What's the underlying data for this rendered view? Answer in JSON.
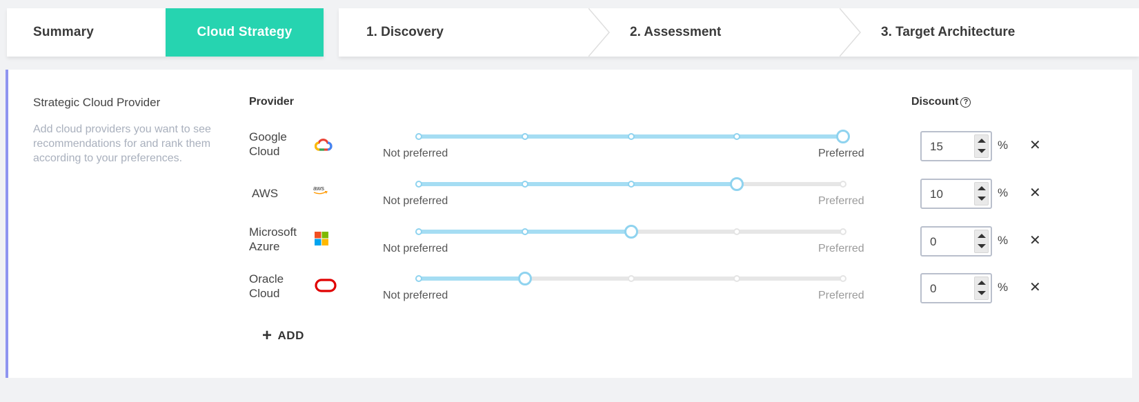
{
  "tabs": {
    "summary": "Summary",
    "active": "Cloud Strategy",
    "steps": [
      "1. Discovery",
      "2. Assessment",
      "3. Target Architecture"
    ]
  },
  "colors": {
    "active_tab": "#26d4b0",
    "accent_border": "#8f95f0",
    "slider_fill": "#a5ddf3",
    "oracle_red": "#e00000"
  },
  "section": {
    "title": "Strategic Cloud Provider",
    "description": "Add cloud providers you want to see recommendations for and rank them according to your preferences."
  },
  "columns": {
    "provider": "Provider",
    "discount": "Discount",
    "help_icon": "?"
  },
  "scale": {
    "min_label": "Not preferred",
    "max_label": "Preferred",
    "steps": 5
  },
  "providers": [
    {
      "name_line1": "Google",
      "name_line2": "Cloud",
      "logo": "google-cloud-logo",
      "preference": 5,
      "discount": "15",
      "unit": "%"
    },
    {
      "name_line1": "AWS",
      "name_line2": "",
      "logo": "aws-logo",
      "preference": 4,
      "discount": "10",
      "unit": "%"
    },
    {
      "name_line1": "Microsoft",
      "name_line2": "Azure",
      "logo": "microsoft-logo",
      "preference": 3,
      "discount": "0",
      "unit": "%"
    },
    {
      "name_line1": "Oracle",
      "name_line2": "Cloud",
      "logo": "oracle-logo",
      "preference": 2,
      "discount": "0",
      "unit": "%"
    }
  ],
  "remove_icon": "✕",
  "add_button": {
    "icon": "+",
    "label": "ADD"
  }
}
